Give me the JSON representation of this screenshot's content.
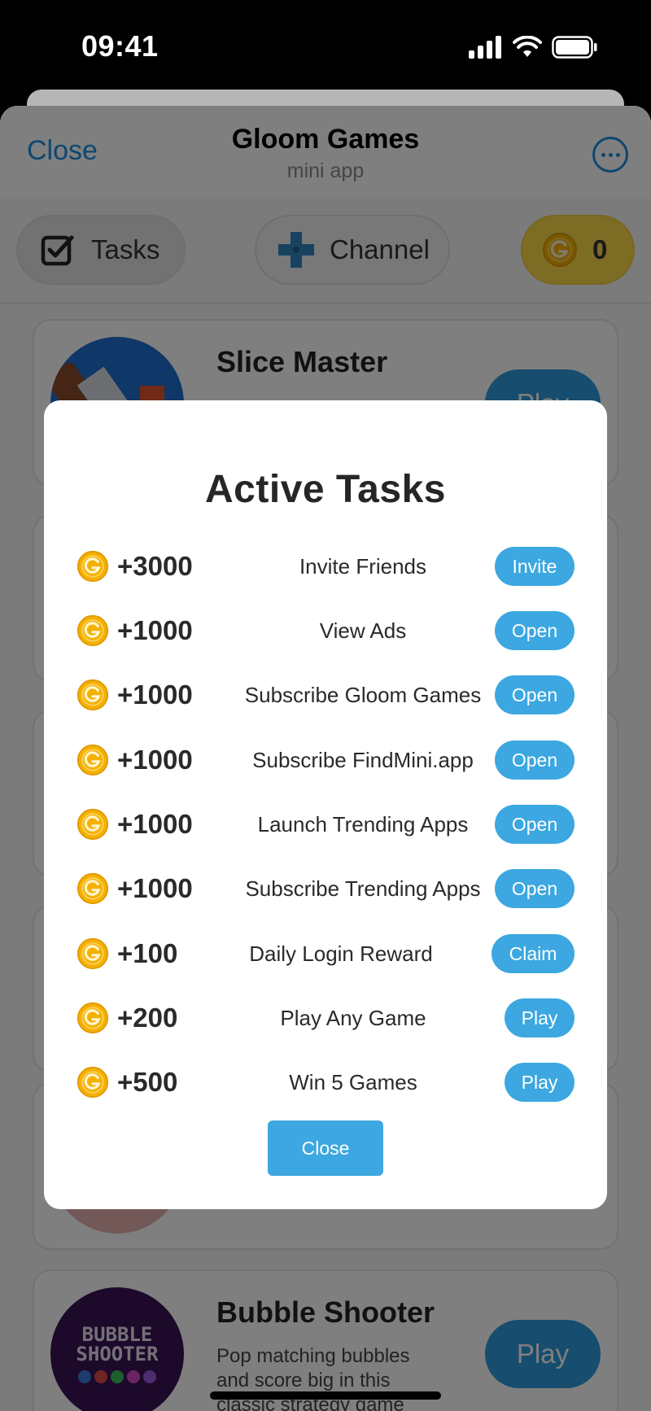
{
  "status_bar": {
    "time": "09:41"
  },
  "header": {
    "close_label": "Close",
    "title": "Gloom Games",
    "subtitle": "mini app"
  },
  "toolbar": {
    "tasks_label": "Tasks",
    "channel_label": "Channel",
    "coins": "0"
  },
  "games": [
    {
      "title": "Slice Master",
      "play_label": "Play"
    },
    {
      "title": "Bubble Shooter",
      "description": "Pop matching bubbles and score big in this classic strategy game",
      "thumb_text": "BUBBLE SHOOTER",
      "play_label": "Play"
    }
  ],
  "modal": {
    "title": "Active Tasks",
    "tasks": [
      {
        "reward": "+3000",
        "name": "Invite Friends",
        "action": "Invite"
      },
      {
        "reward": "+1000",
        "name": "View Ads",
        "action": "Open"
      },
      {
        "reward": "+1000",
        "name": "Subscribe Gloom Games",
        "action": "Open"
      },
      {
        "reward": "+1000",
        "name": "Subscribe FindMini.app",
        "action": "Open"
      },
      {
        "reward": "+1000",
        "name": "Launch Trending Apps",
        "action": "Open"
      },
      {
        "reward": "+1000",
        "name": "Subscribe Trending Apps",
        "action": "Open"
      },
      {
        "reward": "+100",
        "name": "Daily Login Reward",
        "action": "Claim"
      },
      {
        "reward": "+200",
        "name": "Play Any Game",
        "action": "Play"
      },
      {
        "reward": "+500",
        "name": "Win 5 Games",
        "action": "Play"
      }
    ],
    "close_label": "Close"
  },
  "colors": {
    "accent": "#3ca7e0",
    "link": "#1a8fe0",
    "coin": "#f5b000",
    "coins_pill": "#f9d949"
  },
  "icons": {
    "tasks": "checkbox-icon",
    "channel": "dpad-icon",
    "coin": "coin-icon",
    "more": "more-icon"
  }
}
